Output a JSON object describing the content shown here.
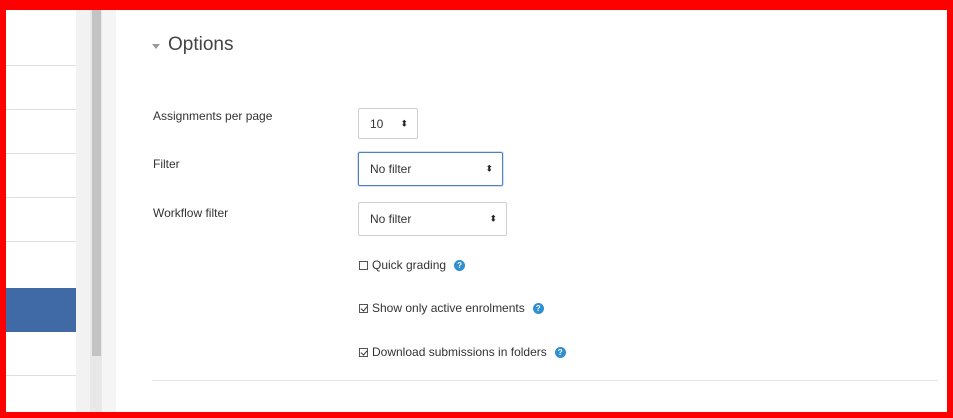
{
  "options": {
    "title": "Options",
    "assignments_per_page": {
      "label": "Assignments per page",
      "value": "10"
    },
    "filter": {
      "label": "Filter",
      "value": "No filter"
    },
    "workflow_filter": {
      "label": "Workflow filter",
      "value": "No filter"
    },
    "quick_grading": {
      "label": "Quick grading",
      "checked": false
    },
    "show_active": {
      "label": "Show only active enrolments",
      "checked": true
    },
    "download_folders": {
      "label": "Download submissions in folders",
      "checked": true
    }
  },
  "icons": {
    "help": "question-circle-icon",
    "collapse": "caret-down-icon"
  },
  "colors": {
    "accent": "#3f6aa5",
    "help": "#2f8fd0",
    "frame": "#ff0000"
  },
  "glyphs": {
    "help": "?",
    "select_arrows": "⬍"
  }
}
